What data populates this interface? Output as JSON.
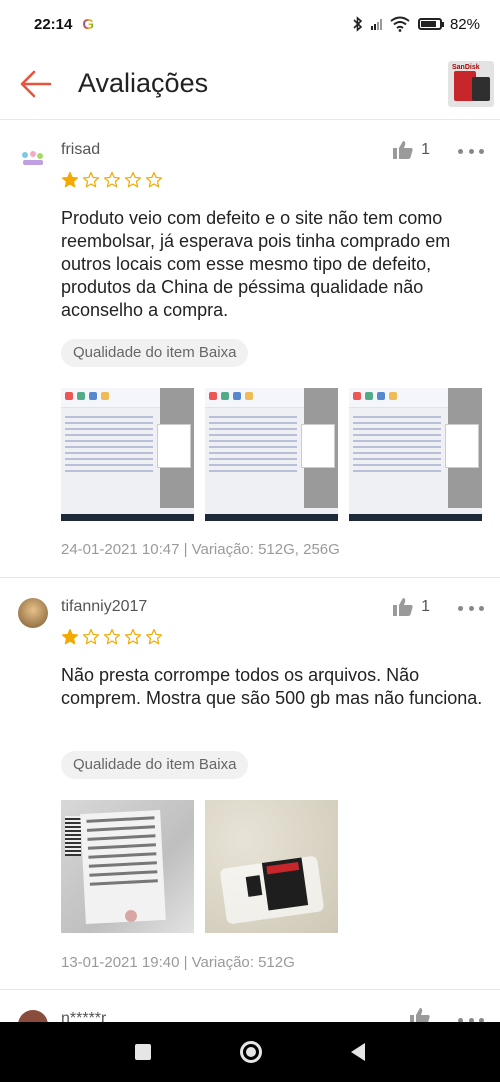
{
  "status_bar": {
    "time": "22:14",
    "google_icon": "google-g-icon",
    "battery_percent": "82%",
    "battery_level": 0.82
  },
  "header": {
    "title": "Avaliações",
    "back_icon": "arrow-left-icon",
    "accent_color": "#e8543c"
  },
  "reviews": [
    {
      "user": "frisad",
      "likes": "1",
      "rating": 1,
      "text": "Produto veio com defeito e o site não tem como reembolsar, já esperava pois tinha comprado em outros locais com esse mesmo tipo de defeito, produtos da China de péssima qualidade não aconselho a compra.",
      "tag": "Qualidade do item Baixa",
      "photo_count": 3,
      "meta": "24-01-2021 10:47 | Variação: 512G, 256G"
    },
    {
      "user": "tifanniy2017",
      "likes": "1",
      "rating": 1,
      "text": "Não presta corrompe todos os arquivos. Não comprem. Mostra que são 500 gb mas não funciona.",
      "tag": "Qualidade do item Baixa",
      "photo_count": 2,
      "meta": "13-01-2021 19:40 | Variação: 512G"
    },
    {
      "user": "n*****r",
      "avatar_letter": "n"
    }
  ],
  "colors": {
    "star_filled": "#f2a900",
    "star_empty": "#f2a900",
    "meta_text": "#9a9a9a"
  }
}
